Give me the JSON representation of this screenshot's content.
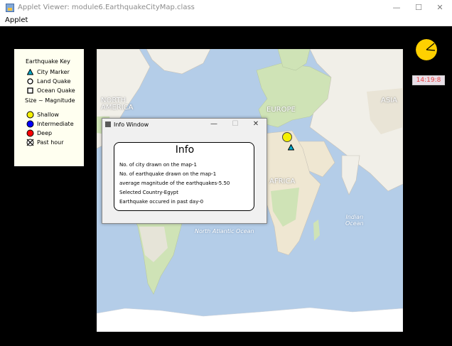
{
  "window": {
    "title": "Applet Viewer: module6.EarthquakeCityMap.class",
    "minimize": "—",
    "maximize": "☐",
    "close": "✕"
  },
  "menu": {
    "applet_label": "Applet"
  },
  "key": {
    "title": "Earthquake Key",
    "items": {
      "city": "City Marker",
      "land": "Land Quake",
      "ocean": "Ocean Quake",
      "size_title": "Size ~ Magnitude",
      "shallow": "Shallow",
      "intermediate": "Intermediate",
      "deep": "Deep",
      "past_hour": "Past hour"
    },
    "colors": {
      "shallow": "#f5f000",
      "intermediate": "#0000ff",
      "deep": "#ff0000",
      "city": "#00aacc"
    }
  },
  "map": {
    "labels": {
      "north_america": "NORTH\nAMERICA",
      "europe": "EUROPE",
      "asia": "ASIA",
      "africa": "AFRICA",
      "north_atlantic": "North Atlantic Ocean",
      "indian_ocean": "Indian\nOcean"
    },
    "colors": {
      "ocean": "#b4cde8",
      "land": "#f1efe8",
      "green": "#cfe3b6"
    }
  },
  "clock": {
    "time": "14:19:8",
    "accent": "#ffd000"
  },
  "info_window": {
    "title": "Info Window",
    "minimize": "—",
    "maximize": "☐",
    "close": "✕",
    "heading": "Info",
    "lines": [
      "No. of city drawn on the map-1",
      "No. of earthquake drawn on the map-1",
      "average magnitude of the earthquakes-5.50",
      "Selected Country-Egypt",
      "Earthquake occured in past day-0"
    ]
  }
}
